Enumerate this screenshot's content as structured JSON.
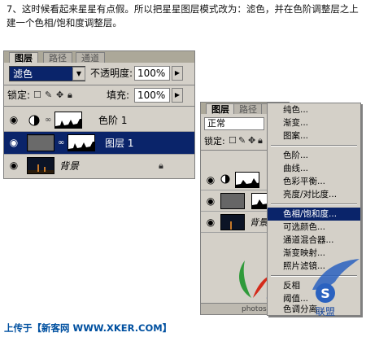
{
  "instruction": "7、这时候看起来星星有点假。所以把星星图层模式改为：滤色，并在色阶调整层之上建一个色相/饱和度调整层。",
  "left_panel": {
    "tabs": [
      "图层",
      "路径",
      "通道"
    ],
    "blend_mode": "滤色",
    "opacity_label": "不透明度:",
    "opacity_value": "100%",
    "lock_label": "锁定:",
    "fill_label": "填充:",
    "fill_value": "100%",
    "layers": [
      {
        "name": "色阶 1",
        "type": "adjustment"
      },
      {
        "name": "图层 1",
        "type": "stars",
        "selected": true
      },
      {
        "name": "背景",
        "type": "background",
        "locked": true
      }
    ]
  },
  "right_panel": {
    "tabs": [
      "图层",
      "路径",
      "通"
    ],
    "blend_mode": "正常",
    "lock_label": "锁定:",
    "layers": [
      {
        "name": ""
      },
      {
        "name": ""
      },
      {
        "name": "背景"
      }
    ],
    "footer_text": "photoshop"
  },
  "context_menu": {
    "items": [
      "纯色...",
      "渐变...",
      "图案...",
      "色阶...",
      "曲线...",
      "色彩平衡...",
      "亮度/对比度...",
      "色相/饱和度...",
      "可选颜色...",
      "通道混合器...",
      "渐变映射...",
      "照片滤镜...",
      "反相",
      "阈值...",
      "色调分离..."
    ],
    "highlighted": "色相/饱和度..."
  },
  "watermark": {
    "site_text": "86",
    "brand_text": "联盟"
  },
  "footer": {
    "text": "上传于【新客网 WWW.XKER.COM】"
  }
}
